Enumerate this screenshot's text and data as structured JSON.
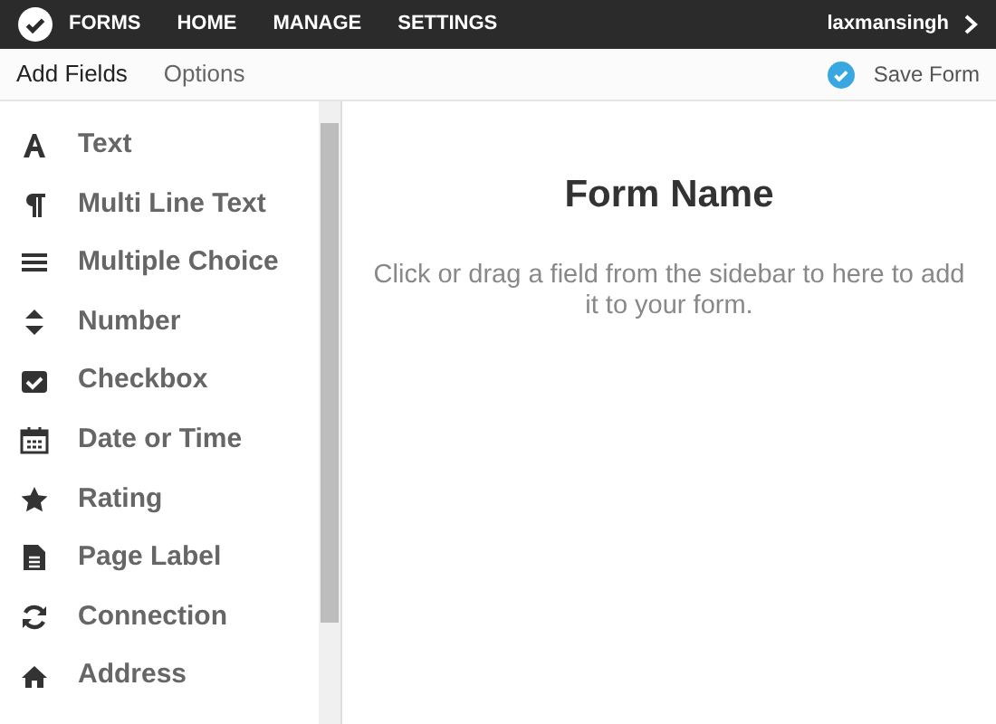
{
  "nav": {
    "items": [
      "FORMS",
      "HOME",
      "MANAGE",
      "SETTINGS"
    ],
    "user": "laxmansingh"
  },
  "tabs": [
    {
      "label": "Add Fields",
      "selected": true
    },
    {
      "label": "Options",
      "selected": false
    }
  ],
  "save_button": "Save Form",
  "fields": [
    "Text",
    "Multi Line Text",
    "Multiple Choice",
    "Number",
    "Checkbox",
    "Date or Time",
    "Rating",
    "Page Label",
    "Connection",
    "Address"
  ],
  "form": {
    "title": "Form Name",
    "hint": "Click or drag a field from the sidebar to here to add it to your form."
  }
}
